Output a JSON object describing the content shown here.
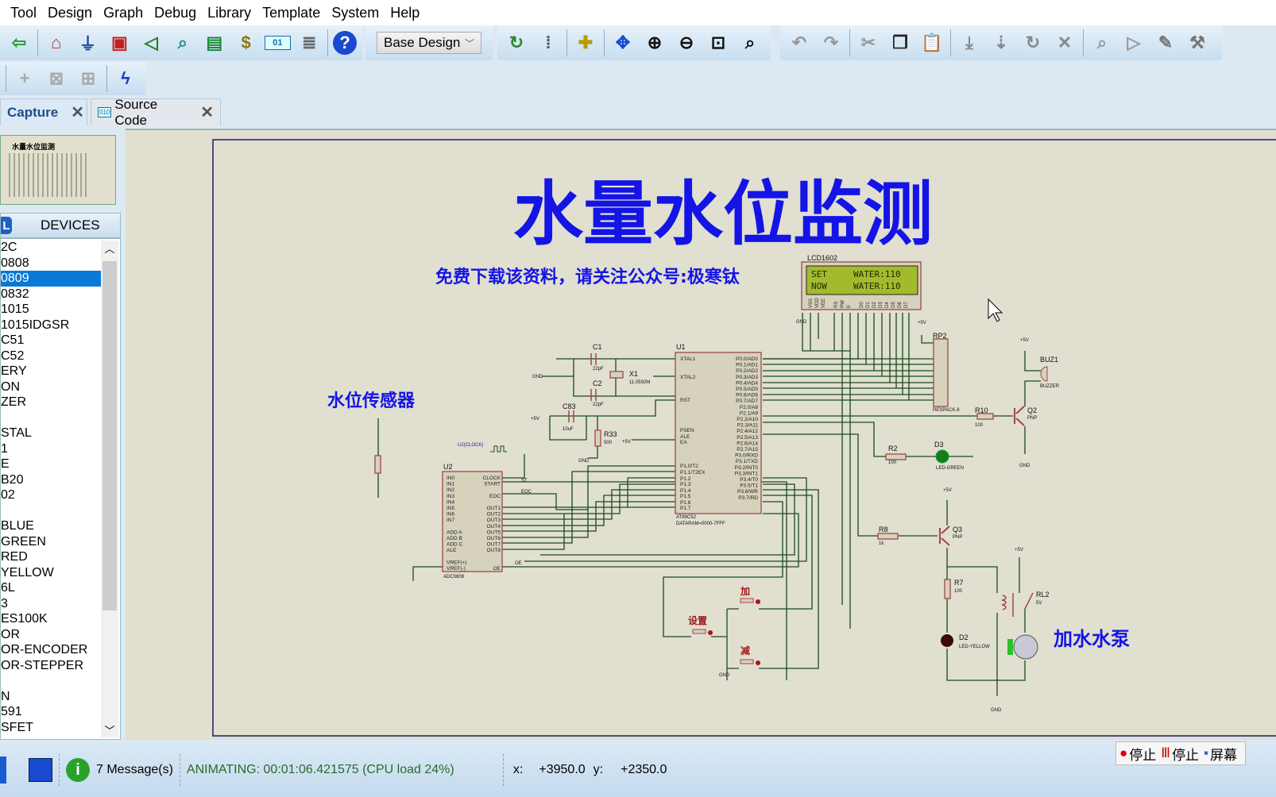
{
  "menu": [
    "Tool",
    "Design",
    "Graph",
    "Debug",
    "Library",
    "Template",
    "System",
    "Help"
  ],
  "toolbar": {
    "group1": [
      {
        "name": "exit-icon",
        "g": "⇦",
        "c": "#2a9a2a"
      },
      {
        "name": "home-icon",
        "g": "⌂",
        "c": "#c8281e"
      },
      {
        "name": "component-mode-icon",
        "g": "⏚",
        "c": "#1a4aa0"
      },
      {
        "name": "chip-icon",
        "g": "▣",
        "c": "#c81e1e"
      },
      {
        "name": "schematic-icon",
        "g": "◁",
        "c": "#2a7a2a"
      },
      {
        "name": "browse-icon",
        "g": "⌕",
        "c": "#2a8a8a"
      },
      {
        "name": "pcb-icon",
        "g": "▤",
        "c": "#1a8a3a"
      },
      {
        "name": "bom-icon",
        "g": "$",
        "c": "#8a7a10"
      },
      {
        "name": "source-code-icon",
        "g": "01",
        "c": "#1a6ab0"
      },
      {
        "name": "document-icon",
        "g": "≣",
        "c": "#666"
      },
      {
        "name": "help-icon",
        "g": "?",
        "c": "#fff"
      }
    ],
    "design_select": "Base Design",
    "group2": [
      {
        "name": "refresh-icon",
        "g": "↻",
        "c": "#2a8a2a"
      },
      {
        "name": "grid-icon",
        "g": "⁞",
        "c": "#555"
      },
      {
        "name": "origin-icon",
        "g": "✚",
        "c": "#b89a00"
      },
      {
        "name": "pan-icon",
        "g": "✥",
        "c": "#1a4ad0"
      },
      {
        "name": "zoom-in-icon",
        "g": "⊕",
        "c": "#111"
      },
      {
        "name": "zoom-out-icon",
        "g": "⊖",
        "c": "#111"
      },
      {
        "name": "zoom-fit-icon",
        "g": "⊡",
        "c": "#111"
      },
      {
        "name": "zoom-area-icon",
        "g": "⌕",
        "c": "#111"
      }
    ],
    "group3": [
      {
        "name": "undo-icon",
        "g": "↶",
        "c": "#999"
      },
      {
        "name": "redo-icon",
        "g": "↷",
        "c": "#999"
      },
      {
        "name": "cut-icon",
        "g": "✂",
        "c": "#999"
      },
      {
        "name": "copy-icon",
        "g": "❐",
        "c": "#222"
      },
      {
        "name": "paste-icon",
        "g": "📋",
        "c": "#999"
      },
      {
        "name": "block-copy-icon",
        "g": "⤓",
        "c": "#888"
      },
      {
        "name": "block-move-icon",
        "g": "⇣",
        "c": "#888"
      },
      {
        "name": "block-rotate-icon",
        "g": "↻",
        "c": "#888"
      },
      {
        "name": "block-delete-icon",
        "g": "✕",
        "c": "#888"
      },
      {
        "name": "pick-device-icon",
        "g": "⌕",
        "c": "#999"
      },
      {
        "name": "make-device-icon",
        "g": "▷",
        "c": "#999"
      },
      {
        "name": "decompose-icon",
        "g": "✎",
        "c": "#777"
      },
      {
        "name": "tools-icon",
        "g": "⚒",
        "c": "#777"
      }
    ],
    "row2": [
      {
        "name": "new-sheet-icon",
        "g": "+",
        "c": "#aaa"
      },
      {
        "name": "delete-sheet-icon",
        "g": "⊠",
        "c": "#aaa"
      },
      {
        "name": "hierarchy-icon",
        "g": "⊞",
        "c": "#aaa"
      },
      {
        "name": "netlist-icon",
        "g": "ϟ",
        "c": "#1a3ad0"
      }
    ]
  },
  "tabs": [
    {
      "label": "Capture",
      "close": "✕"
    },
    {
      "label": "Source Code",
      "close": "✕",
      "icon": "010"
    }
  ],
  "sidebar": {
    "preview_title": "水量水位监测",
    "badge": "L",
    "header": "DEVICES",
    "devices": [
      "2C",
      "0808",
      "0809",
      "0832",
      "1015",
      "1015IDGSR",
      "C51",
      "C52",
      "ERY",
      "ON",
      "ZER",
      "",
      "STAL",
      "1",
      "E",
      "B20",
      "02",
      "",
      "BLUE",
      "GREEN",
      "RED",
      "YELLOW",
      "6L",
      "3",
      "ES100K",
      "OR",
      "OR-ENCODER",
      "OR-STEPPER",
      "",
      "N",
      "591",
      "SFET"
    ],
    "selected_index": 2
  },
  "schematic": {
    "title": "水量水位监测",
    "subtitle": "免费下载该资料，请关注公众号:极寒钛",
    "sensor_label": "水位传感器",
    "pump_label": "加水水泵",
    "title_color": "#1414e6",
    "labels": [
      "LCD1602",
      "SET     WATER:110",
      "NOW     WATER:110",
      "U1",
      "AT89C52",
      "DATARAM=0000-7FFF",
      "U2",
      "ADC0808",
      "C1",
      "22pF",
      "C2",
      "22pF",
      "X1",
      "11.0592M",
      "C83",
      "10uF",
      "R33",
      "500",
      "RP2",
      "RESPACK-8",
      "BUZ1",
      "BUZZER",
      "Q2",
      "PNP",
      "R10",
      "100",
      "R2",
      "100",
      "D3",
      "LED-GREEN",
      "R8",
      "1k",
      "Q3",
      "PNP",
      "R7",
      "100",
      "D2",
      "LED-YELLOW",
      "RL2",
      "5V",
      "加",
      "设置",
      "减",
      "GND",
      "GND",
      "GND",
      "+5V",
      "+5V",
      "+5V",
      "+5V",
      "GND",
      "U2(CLOCK)",
      "ST",
      "EOC",
      "OE",
      "+5V",
      "+5V",
      "GND",
      "GND"
    ],
    "u1_left_pins": [
      "XTAL1",
      "XTAL2",
      "RST",
      "PSEN",
      "ALE",
      "EA",
      "P1.0/T2",
      "P1.1/T2EX",
      "P1.2",
      "P1.3",
      "P1.4",
      "P1.5",
      "P1.6",
      "P1.7"
    ],
    "u1_right_pins": [
      "P0.0/AD0",
      "P0.1/AD1",
      "P0.2/AD2",
      "P0.3/AD3",
      "P0.4/AD4",
      "P0.5/AD5",
      "P0.6/AD6",
      "P0.7/AD7",
      "P2.0/A8",
      "P2.1/A9",
      "P2.2/A10",
      "P2.3/A11",
      "P2.4/A12",
      "P2.5/A13",
      "P2.6/A14",
      "P2.7/A15",
      "P3.0/RXD",
      "P3.1/TXD",
      "P3.2/INT0",
      "P3.3/INT1",
      "P3.4/T0",
      "P3.5/T1",
      "P3.6/WR",
      "P3.7/RD"
    ],
    "u2_left_pins": [
      "IN0",
      "IN1",
      "IN2",
      "IN3",
      "IN4",
      "IN5",
      "IN6",
      "IN7",
      "",
      "ADD A",
      "ADD B",
      "ADD C",
      "ALE",
      "",
      "VREF(+)",
      "VREF(-)"
    ],
    "u2_right_pins": [
      "CLOCK",
      "START",
      "",
      "EOC",
      "",
      "OUT1",
      "OUT2",
      "OUT3",
      "OUT4",
      "OUT5",
      "OUT6",
      "OUT7",
      "OUT8",
      "",
      "",
      "OE"
    ],
    "lcd_pins": [
      "VSS",
      "VDD",
      "VEE",
      "",
      "RS",
      "RW",
      "E",
      "",
      "D0",
      "D1",
      "D2",
      "D3",
      "D4",
      "D5",
      "D6",
      "D7"
    ],
    "lcd_color": "#a4ba2c"
  },
  "status": {
    "messages": "7 Message(s)",
    "animating": "ANIMATING: 00:01:06.421575 (CPU load 24%)",
    "x_label": "x:",
    "x_value": "+3950.0",
    "y_label": "y:",
    "y_value": "+2350.0",
    "buttons": [
      "停止",
      "停止",
      "屏幕"
    ]
  }
}
